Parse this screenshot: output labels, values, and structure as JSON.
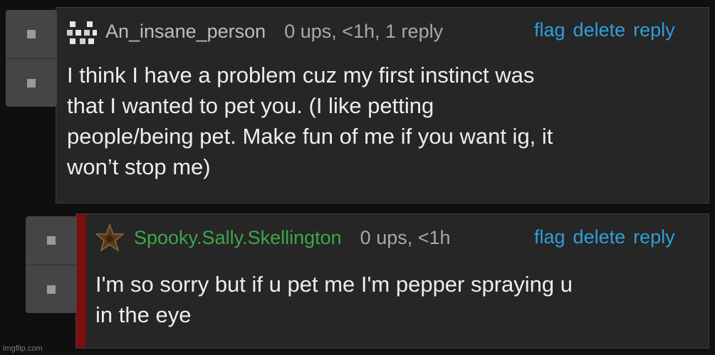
{
  "comment1": {
    "username": "An_insane_person",
    "meta": "0 ups, <1h, 1 reply",
    "actions": {
      "flag": "flag",
      "delete": "delete",
      "reply": "reply"
    },
    "body": "I think I have a problem cuz my first instinct was\nthat I wanted to pet you. (I like petting\npeople/being pet. Make fun of me if you want ig, it\nwon’t stop me)",
    "avatar_icon": "pixel-avatar-icon"
  },
  "comment2": {
    "username": "Spooky.Sally.Skellington",
    "meta": "0 ups, <1h",
    "actions": {
      "flag": "flag",
      "delete": "delete",
      "reply": "reply"
    },
    "body": "I'm so sorry but if u pet me I'm pepper spraying u\nin the eye",
    "avatar_icon": "star-avatar-icon"
  },
  "watermark": "imgflip.com",
  "colors": {
    "link": "#2f9fd9",
    "username_green": "#3fa64a",
    "depth_bar": "#7a0f12"
  }
}
